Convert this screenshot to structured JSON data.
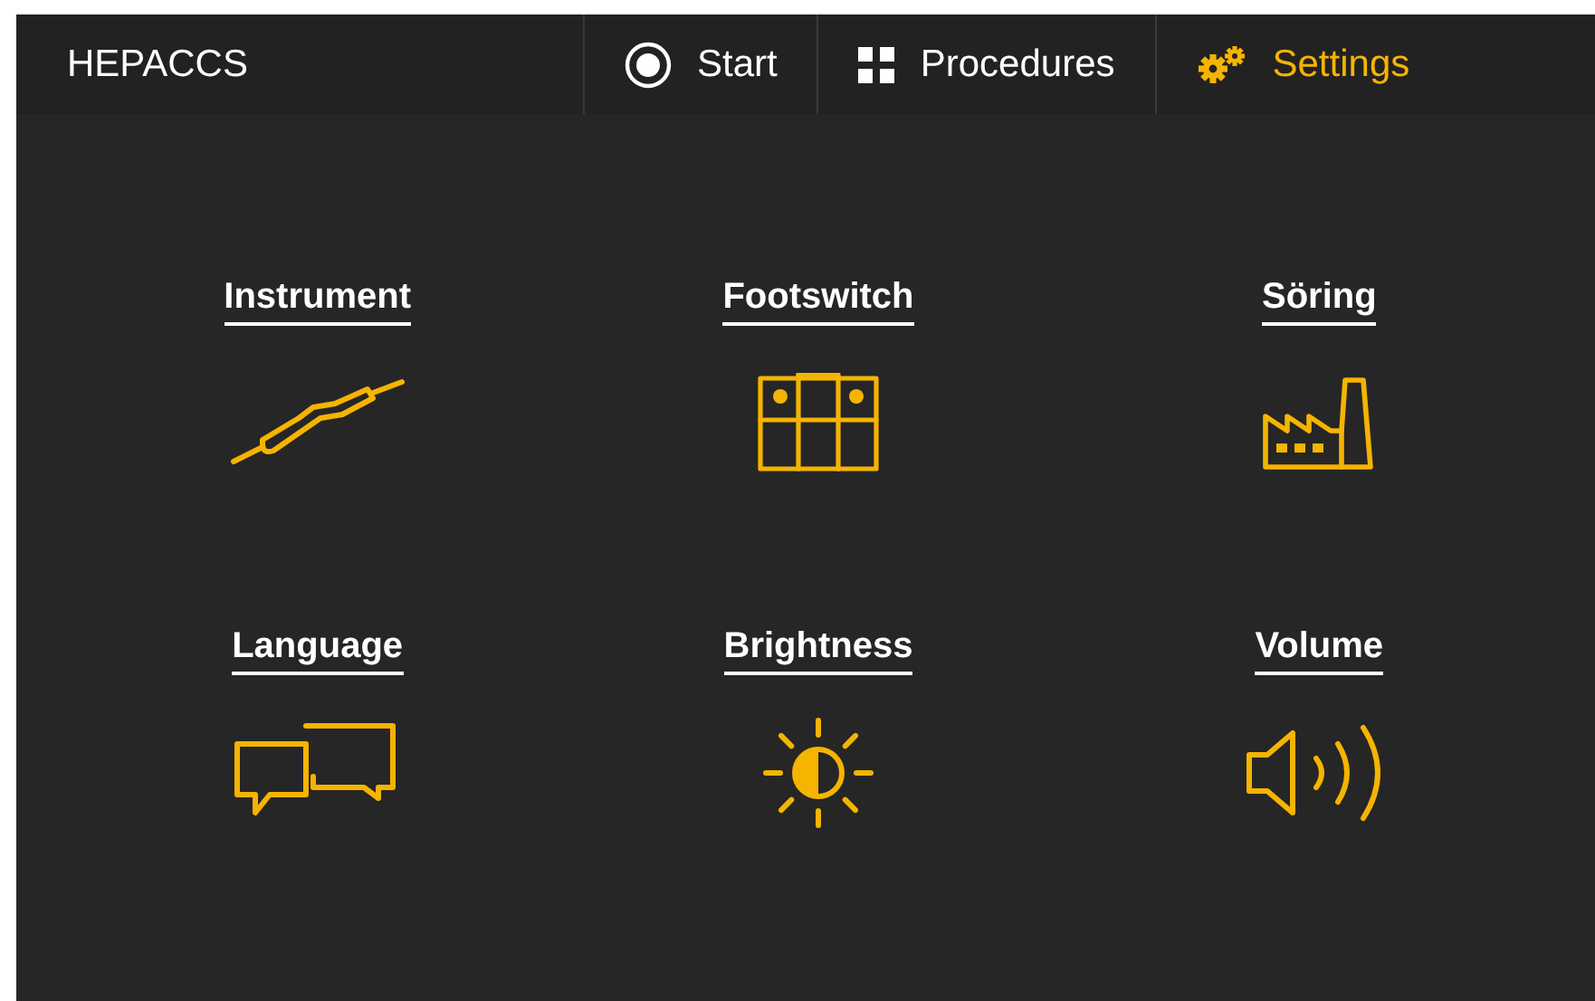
{
  "app_title": "HEPACCS",
  "nav": [
    {
      "label": "Start",
      "kind": "record",
      "selected": false
    },
    {
      "label": "Procedures",
      "kind": "grid",
      "selected": false
    },
    {
      "label": "Settings",
      "kind": "gears",
      "selected": true
    }
  ],
  "tiles": [
    {
      "label": "Instrument",
      "kind": "instrument"
    },
    {
      "label": "Footswitch",
      "kind": "footswitch"
    },
    {
      "label": "Söring",
      "kind": "factory"
    },
    {
      "label": "Language",
      "kind": "language"
    },
    {
      "label": "Brightness",
      "kind": "brightness"
    },
    {
      "label": "Volume",
      "kind": "volume"
    }
  ]
}
